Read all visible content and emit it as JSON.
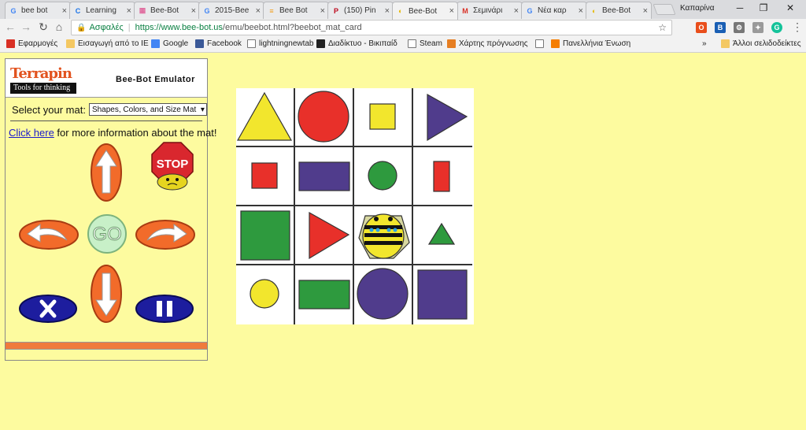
{
  "browser": {
    "tabs": [
      {
        "title": "bee bot",
        "fav": "G",
        "fav_color": "#4285f4",
        "active": false
      },
      {
        "title": "Learning",
        "fav": "C",
        "fav_color": "#1a73e8",
        "active": false
      },
      {
        "title": "Bee-Bot",
        "fav": "▦",
        "fav_color": "#e06c9f",
        "active": false
      },
      {
        "title": "2015-Bee",
        "fav": "G",
        "fav_color": "#4285f4",
        "active": false
      },
      {
        "title": "Bee Bot",
        "fav": "≡",
        "fav_color": "#f39c12",
        "active": false
      },
      {
        "title": "(150) Pin",
        "fav": "P",
        "fav_color": "#bd081c",
        "active": false
      },
      {
        "title": "Bee-Bot",
        "fav": "◐",
        "fav_color": "#e6b800",
        "active": true
      },
      {
        "title": "Σεμινάρι",
        "fav": "M",
        "fav_color": "#d93025",
        "active": false
      },
      {
        "title": "Νέα καρ",
        "fav": "G",
        "fav_color": "#4285f4",
        "active": false
      },
      {
        "title": "Bee-Bot",
        "fav": "◐",
        "fav_color": "#e6b800",
        "active": false
      }
    ],
    "user_name": "Καπαρίνα",
    "window_controls": {
      "minimize": "─",
      "restore": "❐",
      "close": "✕"
    },
    "secure_label": "Ασφαλές",
    "url_host": "https://www.bee-bot.us",
    "url_path": "/emu/beebot.html?beebot_mat_card",
    "bookmarks": [
      {
        "label": "Εφαρμογές",
        "icon": "apps-icon"
      },
      {
        "label": "Εισαγωγή από το IE",
        "icon": "folder-icon"
      },
      {
        "label": "Google",
        "icon": "google-icon"
      },
      {
        "label": "Facebook",
        "icon": "facebook-icon"
      },
      {
        "label": "lightningnewtab",
        "icon": "page-icon"
      },
      {
        "label": "Διαδίκτυο - Βικιπαίδ",
        "icon": "wikipedia-icon"
      },
      {
        "label": "Steam",
        "icon": "page-icon"
      },
      {
        "label": "Χάρτης πρόγνωσης",
        "icon": "map-icon"
      },
      {
        "label": "",
        "icon": "page-icon"
      },
      {
        "label": "Πανελλήνια Ένωση",
        "icon": "blogger-icon"
      }
    ],
    "bookmarks_more": "»",
    "other_bookmarks": "Άλλοι σελιδοδείκτες"
  },
  "emulator": {
    "logo_text": "Terrapin",
    "logo_tagline": "Tools for thinking",
    "title": "Bee-Bot Emulator",
    "select_label": "Select your mat:",
    "mat_selected": "Shapes, Colors, and Size Mat",
    "info_link": "Click here",
    "info_text": " for more information about the mat!",
    "stop_label": "STOP",
    "go_label": "GO",
    "progress_fraction": 1.0
  },
  "colors": {
    "page_bg": "#fdfb9f",
    "button_orange": "#f26b2a",
    "button_blue": "#1d1d9e",
    "go_green": "#c8f0c8",
    "stop_red": "#d9272e",
    "shape_yellow": "#f2e62d",
    "shape_red": "#e8302a",
    "shape_purple": "#503c8c",
    "shape_green": "#2e9a3e"
  },
  "mat": {
    "rows": [
      [
        {
          "shape": "triangle",
          "size": "large",
          "color": "yellow"
        },
        {
          "shape": "circle",
          "size": "large",
          "color": "red"
        },
        {
          "shape": "square",
          "size": "small",
          "color": "yellow"
        },
        {
          "shape": "triangle-right",
          "size": "large",
          "color": "purple"
        }
      ],
      [
        {
          "shape": "square",
          "size": "small",
          "color": "red"
        },
        {
          "shape": "rectangle",
          "size": "large",
          "color": "purple"
        },
        {
          "shape": "circle",
          "size": "small",
          "color": "green"
        },
        {
          "shape": "rectangle-tall",
          "size": "small",
          "color": "red"
        }
      ],
      [
        {
          "shape": "square",
          "size": "large",
          "color": "green"
        },
        {
          "shape": "triangle-right",
          "size": "large",
          "color": "red"
        },
        {
          "shape": "bee-bot",
          "size": "large",
          "color": "yellow"
        },
        {
          "shape": "triangle",
          "size": "small",
          "color": "green"
        }
      ],
      [
        {
          "shape": "circle",
          "size": "small",
          "color": "yellow"
        },
        {
          "shape": "rectangle",
          "size": "large",
          "color": "green"
        },
        {
          "shape": "circle",
          "size": "large",
          "color": "purple"
        },
        {
          "shape": "square",
          "size": "large",
          "color": "purple"
        }
      ]
    ]
  }
}
